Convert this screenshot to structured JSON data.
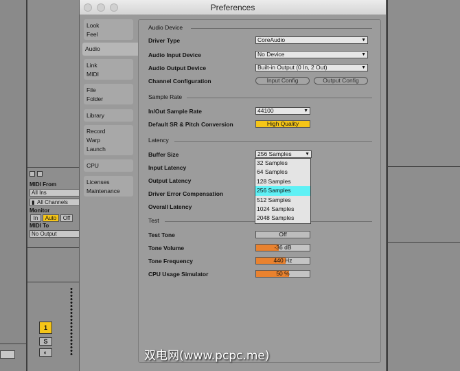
{
  "window": {
    "title": "Preferences"
  },
  "tabs": [
    {
      "lines": [
        "Look",
        "Feel"
      ]
    },
    {
      "lines": [
        "Audio"
      ]
    },
    {
      "lines": [
        "Link",
        "MIDI"
      ]
    },
    {
      "lines": [
        "File",
        "Folder"
      ]
    },
    {
      "lines": [
        "Library"
      ]
    },
    {
      "lines": [
        "Record",
        "Warp",
        "Launch"
      ]
    },
    {
      "lines": [
        "CPU"
      ]
    },
    {
      "lines": [
        "Licenses",
        "Maintenance"
      ]
    }
  ],
  "audio_device": {
    "header": "Audio Device",
    "driver_type_label": "Driver Type",
    "driver_type_value": "CoreAudio",
    "input_device_label": "Audio Input Device",
    "input_device_value": "No Device",
    "output_device_label": "Audio Output Device",
    "output_device_value": "Built-in Output (0 In, 2 Out)",
    "channel_config_label": "Channel Configuration",
    "input_config_button": "Input Config",
    "output_config_button": "Output Config"
  },
  "sample_rate": {
    "header": "Sample Rate",
    "rate_label": "In/Out Sample Rate",
    "rate_value": "44100",
    "conversion_label": "Default SR & Pitch Conversion",
    "conversion_value": "High Quality"
  },
  "latency": {
    "header": "Latency",
    "buffer_label": "Buffer Size",
    "buffer_value": "256 Samples",
    "input_latency_label": "Input Latency",
    "output_latency_label": "Output Latency",
    "driver_comp_label": "Driver Error Compensation",
    "overall_label": "Overall Latency",
    "buffer_options": [
      "32 Samples",
      "64 Samples",
      "128 Samples",
      "256 Samples",
      "512 Samples",
      "1024 Samples",
      "2048 Samples"
    ],
    "selected_index": 3
  },
  "test": {
    "header": "Test",
    "tone_label": "Test Tone",
    "tone_value": "Off",
    "volume_label": "Tone Volume",
    "volume_value": "-36 dB",
    "volume_fraction": 0.42,
    "frequency_label": "Tone Frequency",
    "frequency_value": "440 Hz",
    "frequency_fraction": 0.55,
    "cpu_label": "CPU Usage Simulator",
    "cpu_value": "50 %",
    "cpu_fraction": 0.62
  },
  "daw": {
    "midi_from_label": "MIDI From",
    "midi_from_value": "All Ins",
    "channels_value": "All Channels",
    "monitor_label": "Monitor",
    "monitor_options": [
      "In",
      "Auto",
      "Off"
    ],
    "monitor_selected": "Auto",
    "midi_to_label": "MIDI To",
    "midi_to_value": "No Output",
    "track_number": "1",
    "solo_label": "S"
  },
  "watermark": "双电网(www.pcpc.me)",
  "colors": {
    "accent_yellow": "#f5c518",
    "slider_orange": "#e9822f",
    "highlight_cyan": "#5ff1f5"
  }
}
